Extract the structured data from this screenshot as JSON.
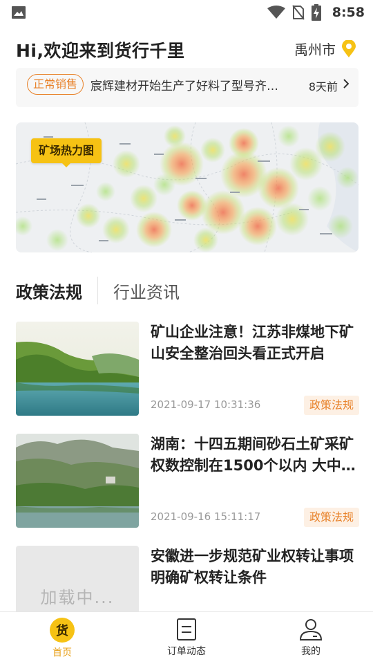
{
  "status_bar": {
    "time": "8:58"
  },
  "header": {
    "greeting": "Hi,欢迎来到货行千里",
    "city": "禹州市"
  },
  "notice": {
    "badge": "正常销售",
    "text": "宸辉建材开始生产了好料了型号齐…",
    "time": "8天前"
  },
  "map": {
    "label": "矿场热力图"
  },
  "tabs": [
    {
      "label": "政策法规",
      "active": true
    },
    {
      "label": "行业资讯",
      "active": false
    }
  ],
  "articles": [
    {
      "title": "矿山企业注意！江苏非煤地下矿山安全整治回头看正式开启",
      "date": "2021-09-17 10:31:36",
      "tag": "政策法规"
    },
    {
      "title": "湖南：十四五期间砂石土矿采矿权数控制在1500个以内 大中…",
      "date": "2021-09-16 15:11:17",
      "tag": "政策法规"
    },
    {
      "title": "安徽进一步规范矿业权转让事项明确矿权转让条件",
      "loading": "加载中..."
    }
  ],
  "bottom_nav": [
    {
      "label": "首页",
      "icon": "货",
      "active": true
    },
    {
      "label": "订单动态",
      "active": false
    },
    {
      "label": "我的",
      "active": false
    }
  ],
  "colors": {
    "accent": "#e8822a",
    "brand_yellow": "#f6c214"
  }
}
